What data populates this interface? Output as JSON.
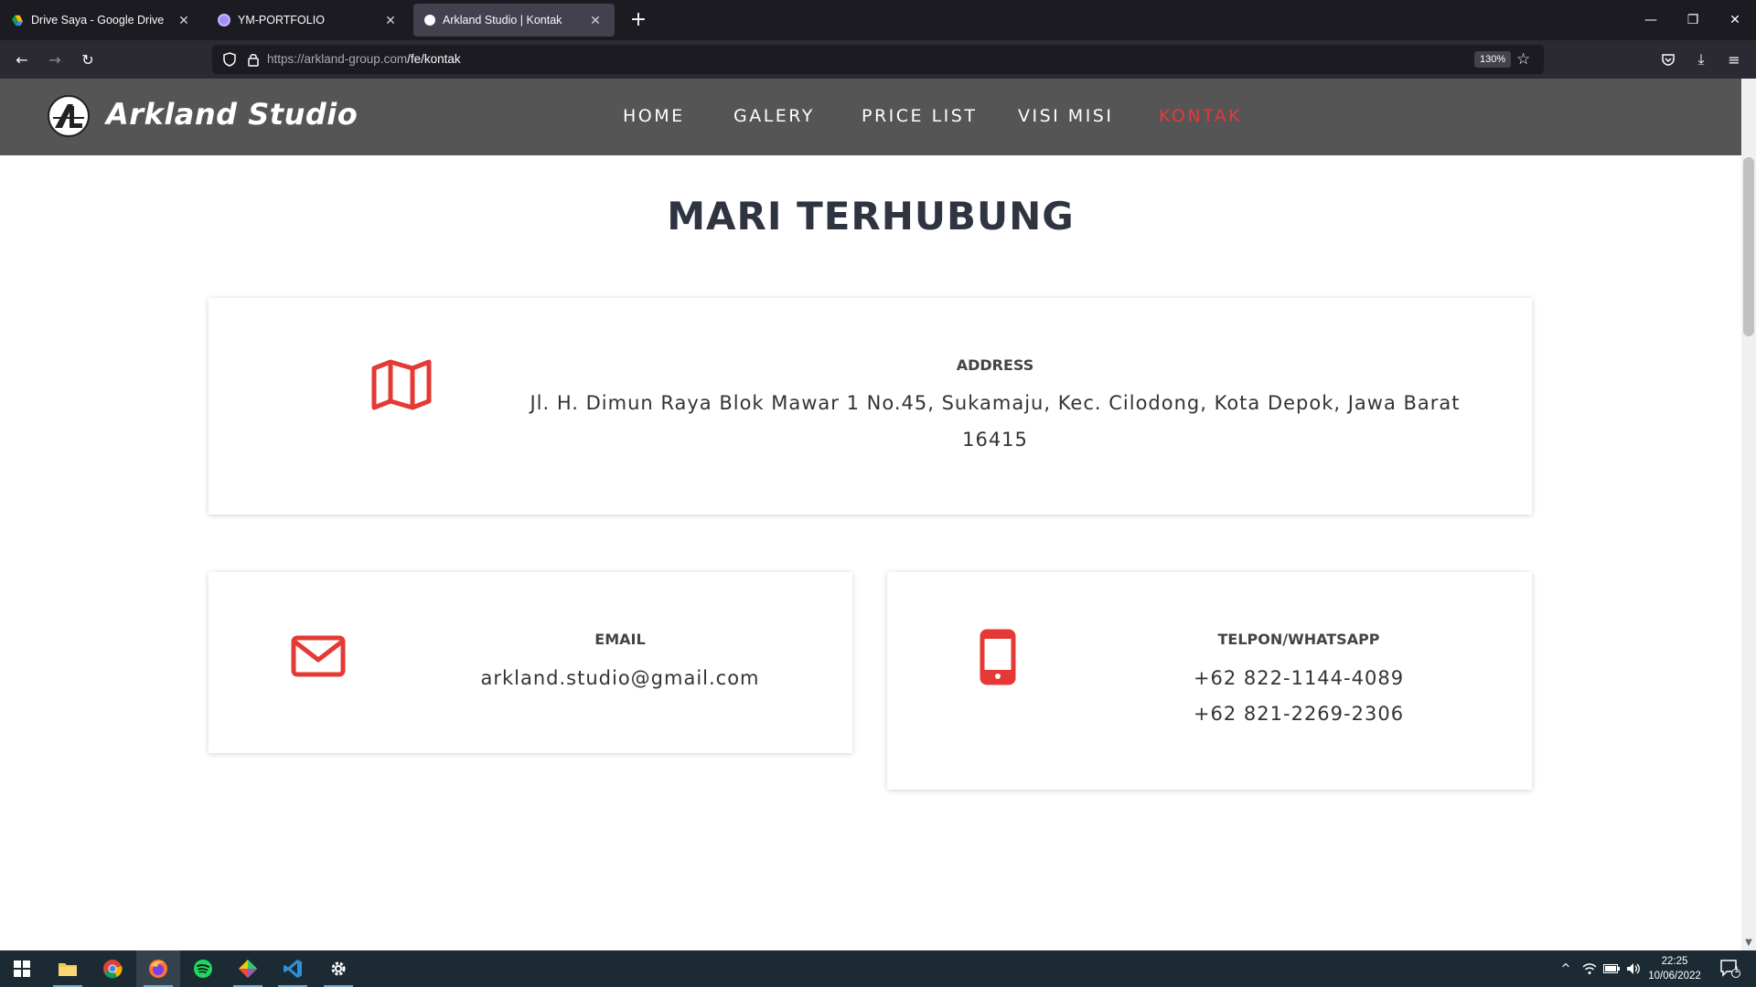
{
  "browser": {
    "tabs": [
      {
        "title": "Drive Saya - Google Drive",
        "active": false
      },
      {
        "title": "YM-PORTFOLIO",
        "active": false
      },
      {
        "title": "Arkland Studio | Kontak",
        "active": true
      }
    ],
    "url_host": "https://arkland-group.com",
    "url_path": "/fe/kontak",
    "zoom": "130%"
  },
  "site": {
    "brand": "Arkland Studio",
    "logo_letters": "AL",
    "menu": [
      {
        "label": "HOME",
        "active": false
      },
      {
        "label": "GALERY",
        "active": false
      },
      {
        "label": "PRICE LIST",
        "active": false
      },
      {
        "label": "VISI MISI",
        "active": false
      },
      {
        "label": "KONTAK",
        "active": true
      }
    ]
  },
  "page": {
    "title": "MARI TERHUBUNG",
    "address": {
      "label": "ADDRESS",
      "line1": "Jl. H. Dimun Raya Blok Mawar 1 No.45, Sukamaju, Kec. Cilodong, Kota Depok, Jawa Barat",
      "line2": "16415"
    },
    "email": {
      "label": "EMAIL",
      "value": "arkland.studio@gmail.com"
    },
    "phone": {
      "label": "TELPON/WHATSAPP",
      "line1": "+62 822-1144-4089",
      "line2": "+62 821-2269-2306"
    }
  },
  "taskbar": {
    "time": "22:25",
    "date": "10/06/2022",
    "notification_count": "1"
  },
  "colors": {
    "accent": "#e53935",
    "header_bg": "#555555",
    "browser_bg": "#1c1b22",
    "taskbar_bg": "#1b2a33"
  }
}
